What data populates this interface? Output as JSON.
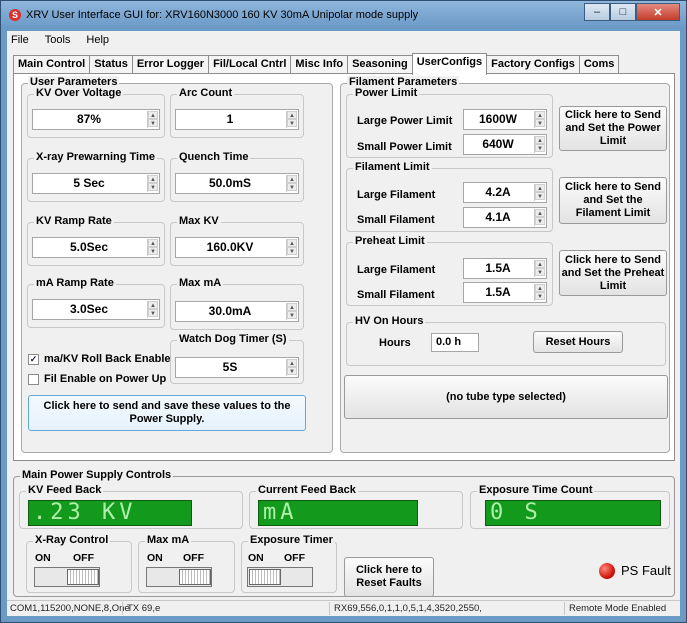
{
  "window": {
    "title": "XRV User Interface GUI for: XRV160N3000 160 KV 30mA Unipolar mode supply",
    "app_icon": "S",
    "minimize": "–",
    "maximize": "□",
    "close": "✕"
  },
  "menu": [
    "File",
    "Tools",
    "Help"
  ],
  "tabs": [
    "Main Control",
    "Status",
    "Error Logger",
    "Fil/Local Cntrl",
    "Misc Info",
    "Seasoning",
    "UserConfigs",
    "Factory Configs",
    "Coms"
  ],
  "active_tab": "UserConfigs",
  "user_params": {
    "title": "User Parameters",
    "kv_over_voltage": {
      "label": "KV Over Voltage",
      "value": "87%"
    },
    "arc_count": {
      "label": "Arc Count",
      "value": "1"
    },
    "xray_prewarning": {
      "label": "X-ray Prewarning Time",
      "value": "5 Sec"
    },
    "quench_time": {
      "label": "Quench Time",
      "value": "50.0mS"
    },
    "kv_ramp": {
      "label": "KV Ramp Rate",
      "value": "5.0Sec"
    },
    "max_kv": {
      "label": "Max KV",
      "value": "160.0KV"
    },
    "ma_ramp": {
      "label": "mA Ramp Rate",
      "value": "3.0Sec"
    },
    "max_ma": {
      "label": "Max mA",
      "value": "30.0mA"
    },
    "watchdog": {
      "label": "Watch Dog Timer (S)",
      "value": "5S"
    },
    "rollback": {
      "label": "ma/KV Roll Back Enable",
      "checked": true
    },
    "fil_enable": {
      "label": "Fil Enable on Power Up",
      "checked": false
    },
    "save_button": "Click here to send and save these values to the Power Supply."
  },
  "filament_params": {
    "title": "Filament Parameters",
    "power_limit": {
      "title": "Power Limit",
      "large_label": "Large Power Limit",
      "large_value": "1600W",
      "small_label": "Small Power Limit",
      "small_value": "640W",
      "button": "Click here to Send and Set the Power Limit"
    },
    "filament_limit": {
      "title": "Filament Limit",
      "large_label": "Large Filament",
      "large_value": "4.2A",
      "small_label": "Small Filament",
      "small_value": "4.1A",
      "button": "Click here to Send and Set the Filament Limit"
    },
    "preheat_limit": {
      "title": "Preheat Limit",
      "large_label": "Large Filament",
      "large_value": "1.5A",
      "small_label": "Small Filament",
      "small_value": "1.5A",
      "button": "Click here to Send and Set the Preheat Limit"
    },
    "hv_hours": {
      "title": "HV On Hours",
      "label": "Hours",
      "value": "0.0 h",
      "reset_button": "Reset Hours"
    },
    "tube_type": "(no tube type selected)"
  },
  "main_controls": {
    "title": "Main Power Supply Controls",
    "kv_feedback": {
      "label": "KV Feed Back",
      "display": ".23 KV"
    },
    "current_feedback": {
      "label": "Current Feed Back",
      "display": "mA"
    },
    "exposure_count": {
      "label": "Exposure Time Count",
      "display": "0 S"
    },
    "xray_control": {
      "label": "X-Ray Control",
      "on": "ON",
      "off": "OFF"
    },
    "max_ma": {
      "label": "Max mA",
      "on": "ON",
      "off": "OFF"
    },
    "exposure_timer": {
      "label": "Exposure Timer",
      "on": "ON",
      "off": "OFF"
    },
    "reset_faults": "Click here to Reset Faults",
    "ps_fault": "PS Fault"
  },
  "status": {
    "com": "COM1,115200,NONE,8,One",
    "tx": "TX 69,e",
    "rx": "RX69,556,0,1,1,0,5,1,4,3520,2550,",
    "mode": "Remote Mode Enabled"
  }
}
